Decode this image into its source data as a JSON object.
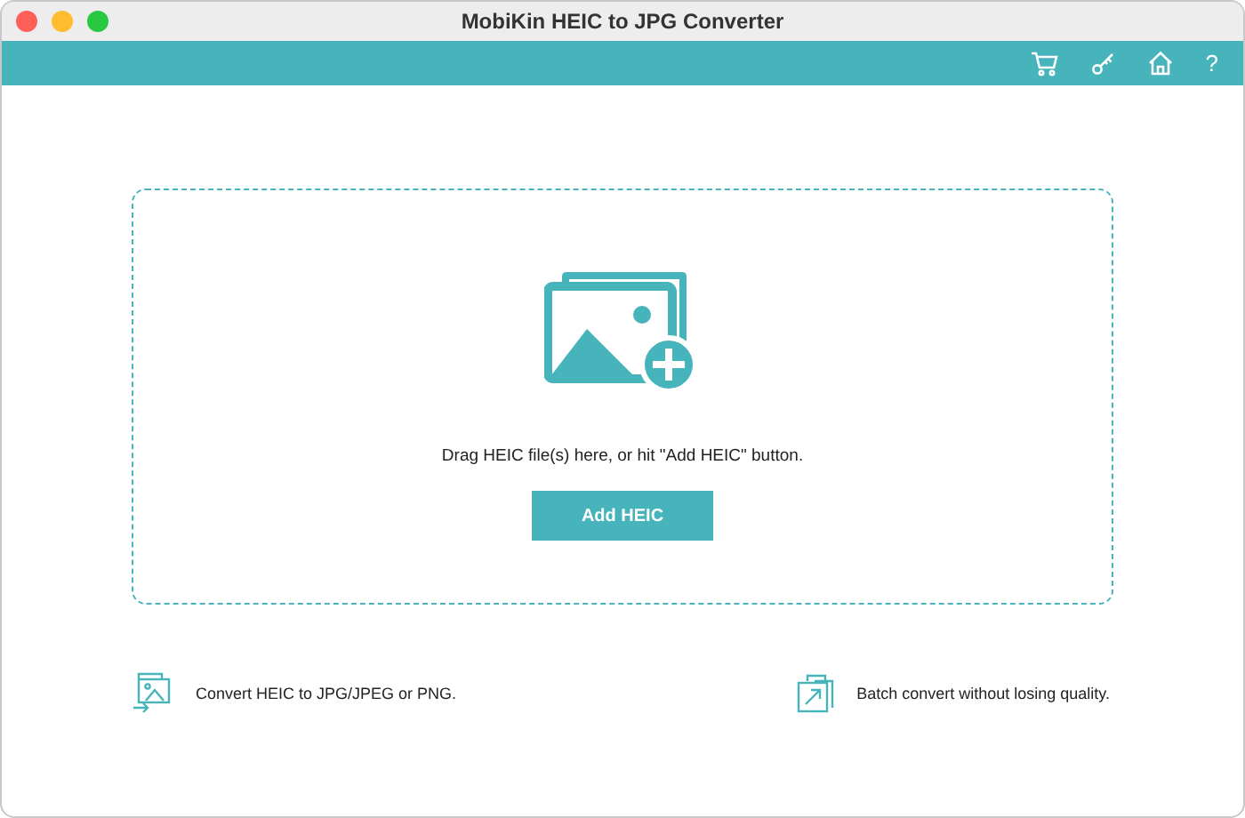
{
  "window": {
    "title": "MobiKin HEIC to JPG Converter"
  },
  "toolbar": [
    {
      "kind": "cart"
    },
    {
      "kind": "key"
    },
    {
      "kind": "home"
    },
    {
      "kind": "text",
      "label": "?"
    }
  ],
  "drop_zone": {
    "hint": "Drag HEIC file(s) here, or hit \"Add HEIC\" button.",
    "button": "Add HEIC"
  },
  "features": [
    {
      "kind": "convert",
      "text": "Convert HEIC to JPG/JPEG or PNG."
    },
    {
      "kind": "batch",
      "text": "Batch convert without losing quality."
    }
  ]
}
